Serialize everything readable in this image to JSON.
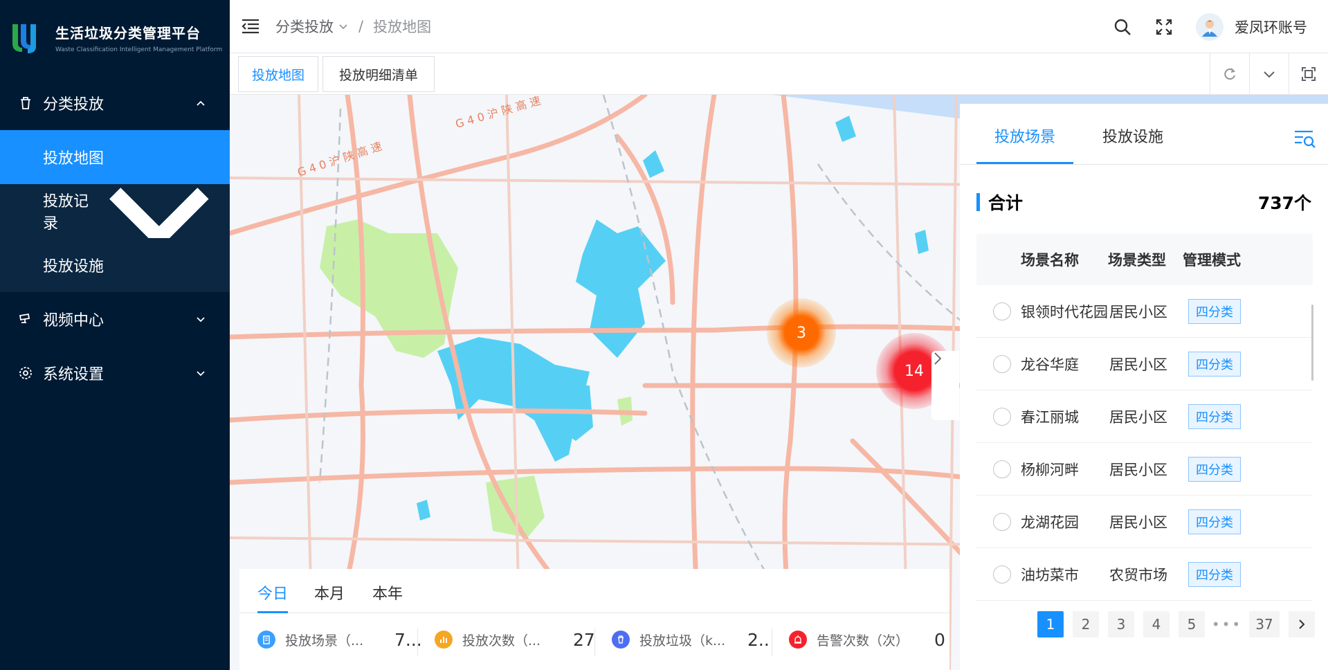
{
  "brand": {
    "title": "生活垃圾分类管理平台",
    "subtitle": "Waste Classification Intelligent Management Platform"
  },
  "sidebar": {
    "items": [
      {
        "label": "分类投放",
        "icon": "trash-icon",
        "expanded": true
      },
      {
        "label": "投放地图",
        "sub": true,
        "active": true
      },
      {
        "label": "投放记录",
        "sub": true
      },
      {
        "label": "投放设施",
        "sub": true
      },
      {
        "label": "视频中心",
        "icon": "camera-icon"
      },
      {
        "label": "系统设置",
        "icon": "gear-icon"
      }
    ]
  },
  "header": {
    "breadcrumb": [
      "分类投放",
      "投放地图"
    ],
    "username": "爱凤环账号"
  },
  "tabs": [
    {
      "label": "投放地图",
      "active": true
    },
    {
      "label": "投放明细清单"
    }
  ],
  "map": {
    "clusters": [
      {
        "count": "3",
        "color": "#ff6a00"
      },
      {
        "count": "14",
        "color": "#f5222d"
      }
    ],
    "road_labels": [
      "G 4 0 沪 陕 高 速",
      "G 4 0 沪 陕 高 速"
    ]
  },
  "panel": {
    "tabs": [
      {
        "label": "投放场景",
        "active": true
      },
      {
        "label": "投放设施"
      }
    ],
    "total_label": "合计",
    "total_value": "737个",
    "columns": [
      "场景名称",
      "场景类型",
      "管理模式"
    ],
    "rows": [
      {
        "name": "银领时代花园",
        "type": "居民小区",
        "mode": "四分类"
      },
      {
        "name": "龙谷华庭",
        "type": "居民小区",
        "mode": "四分类"
      },
      {
        "name": "春江丽城",
        "type": "居民小区",
        "mode": "四分类"
      },
      {
        "name": "杨柳河畔",
        "type": "居民小区",
        "mode": "四分类"
      },
      {
        "name": "龙湖花园",
        "type": "居民小区",
        "mode": "四分类"
      },
      {
        "name": "油坊菜市",
        "type": "农贸市场",
        "mode": "四分类"
      }
    ],
    "pages": [
      "1",
      "2",
      "3",
      "4",
      "5"
    ],
    "page_dots": "•••",
    "last_page": "37",
    "current_page": 1
  },
  "stats": {
    "tabs": [
      {
        "label": "今日",
        "active": true
      },
      {
        "label": "本月"
      },
      {
        "label": "本年"
      }
    ],
    "items": [
      {
        "label": "投放场景（...",
        "value": "7...",
        "color": "#3aa0ff",
        "icon": "building-icon"
      },
      {
        "label": "投放次数（...",
        "value": "27",
        "color": "#f5a623",
        "icon": "bar-chart-icon"
      },
      {
        "label": "投放垃圾（k...",
        "value": "2..",
        "color": "#4e6ef2",
        "icon": "trash-icon"
      },
      {
        "label": "告警次数（次）",
        "value": "0",
        "color": "#f5222d",
        "icon": "alarm-icon"
      }
    ]
  }
}
